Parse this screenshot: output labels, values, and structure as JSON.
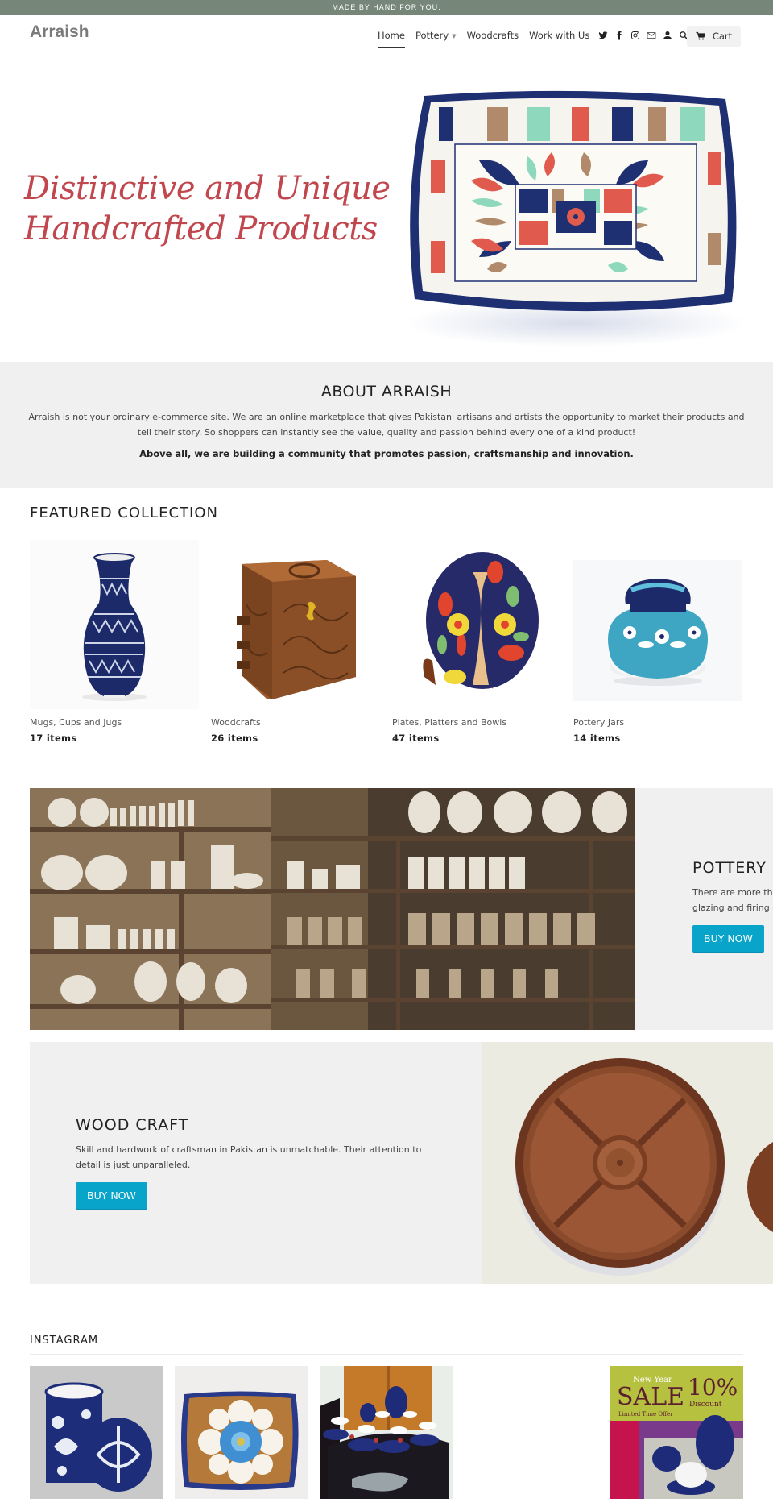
{
  "announcement": "MADE BY HAND FOR YOU.",
  "header": {
    "logo": "Arraish",
    "nav": [
      {
        "label": "Home",
        "active": true
      },
      {
        "label": "Pottery",
        "has_dropdown": true
      },
      {
        "label": "Woodcrafts"
      },
      {
        "label": "Work with Us"
      }
    ],
    "icons": [
      "twitter-icon",
      "facebook-icon",
      "instagram-icon",
      "email-icon",
      "account-icon",
      "search-icon"
    ],
    "cart_label": "Cart"
  },
  "hero": {
    "tagline_line1": "Distinctive and Unique",
    "tagline_line2": "Handcrafted Products",
    "image": "hand-painted rectangular ceramic dish",
    "tagline_color": "#c1474f"
  },
  "about": {
    "title": "ABOUT ARRAISH",
    "description": "Arraish is not your ordinary e-commerce site. We are an online marketplace that gives Pakistani artisans and artists the opportunity to market their products and tell their story. So shoppers can instantly see the value, quality and passion behind every one of a kind product!",
    "highlight": "Above all, we are building a community that promotes passion, craftsmanship and innovation."
  },
  "featured": {
    "title": "FEATURED COLLECTION",
    "collections": [
      {
        "name": "Mugs, Cups and Jugs",
        "count": "17 items",
        "image": "blue pottery vase"
      },
      {
        "name": "Woodcrafts",
        "count": "26 items",
        "image": "carved wooden box"
      },
      {
        "name": "Plates, Platters and Bowls",
        "count": "47 items",
        "image": "painted floral plate"
      },
      {
        "name": "Pottery Jars",
        "count": "14 items",
        "image": "turquoise lidded jar"
      }
    ]
  },
  "pottery_banner": {
    "title": "POTTERY",
    "text_line1": "There are more tha",
    "text_line2": "glazing and firing ea",
    "button": "BUY NOW",
    "image": "pottery workshop shelves"
  },
  "wood_banner": {
    "title": "WOOD CRAFT",
    "text": "Skill and hardwork of craftsman in Pakistan is unmatchable. Their attention to detail is just unparalleled.",
    "button": "BUY NOW",
    "image": "wooden divided serving tray"
  },
  "instagram": {
    "title": "INSTAGRAM",
    "posts": [
      {
        "image": "blue pottery canister with lid"
      },
      {
        "image": "square blue pottery platter"
      },
      {
        "image": "floral tea set on table"
      },
      {
        "image": "new year sale promo",
        "sale_heading": "New Year",
        "sale_word": "SALE",
        "discount": "10%",
        "discount_label": "Discount",
        "offer": "Limited Time Offer"
      }
    ]
  },
  "colors": {
    "announcement_bg": "#768779",
    "button_bg": "#08a4c9",
    "section_bg": "#f0f0f0"
  }
}
